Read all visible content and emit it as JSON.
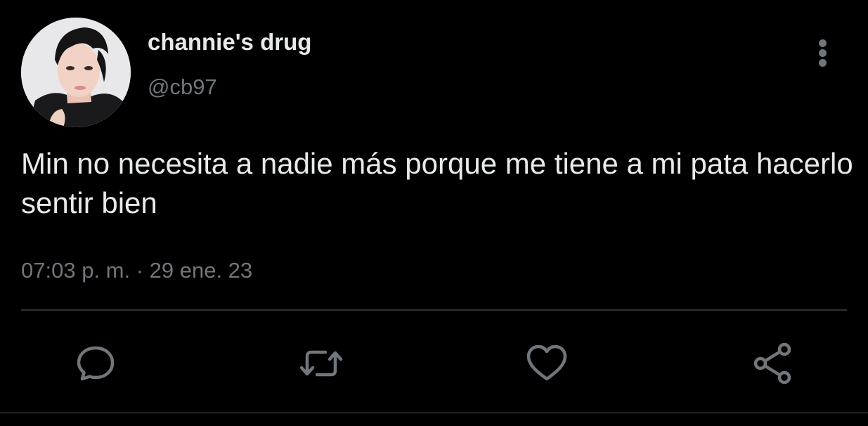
{
  "tweet": {
    "author": {
      "display_name": "channie's drug",
      "handle": "@cb97"
    },
    "text": "Min no necesita a nadie más porque me tiene a mi pata hacerlo sentir bien",
    "timestamp": "07:03 p. m. · 29 ene. 23"
  },
  "actions": [
    {
      "icon": "reply-icon"
    },
    {
      "icon": "retweet-icon"
    },
    {
      "icon": "like-icon"
    },
    {
      "icon": "share-icon"
    }
  ],
  "colors": {
    "background": "#000000",
    "primary_text": "#e7e9ea",
    "secondary_text": "#71767b",
    "divider": "#2f3336"
  }
}
